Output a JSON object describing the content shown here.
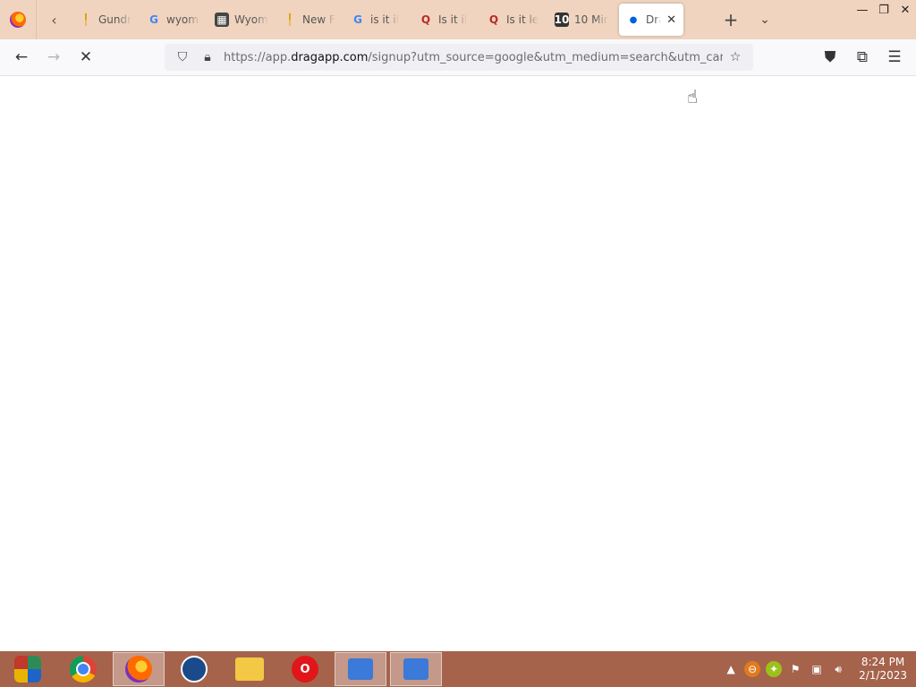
{
  "browser": {
    "tabs": [
      {
        "title": "Gundr",
        "icon": "pin-favicon-icon"
      },
      {
        "title": "wyomi",
        "icon": "google-icon"
      },
      {
        "title": "Wyom",
        "icon": "image-favicon-icon"
      },
      {
        "title": "New F",
        "icon": "pin-favicon-icon"
      },
      {
        "title": "is it il",
        "icon": "google-icon"
      },
      {
        "title": "Is it il",
        "icon": "quora-icon"
      },
      {
        "title": "Is it le",
        "icon": "quora-icon"
      },
      {
        "title": "10 Min",
        "icon": "ten-favicon-icon"
      },
      {
        "title": "Dra",
        "icon": "loading-dot-icon",
        "active": true
      }
    ],
    "url_prefix": "https://app.",
    "url_domain": "dragapp.com",
    "url_rest": "/signup?utm_source=google&utm_medium=search&utm_campaign=drag",
    "new_tab_label": "+",
    "accent": "#0060df",
    "tab_strip_color": "#f0d4bf"
  },
  "taskbar": {
    "color": "#a5634b",
    "apps": [
      "windows-media-center-icon",
      "chrome-icon",
      "firefox-icon",
      "obama-logo-icon",
      "file-explorer-icon",
      "opera-icon",
      "network-icon",
      "network-icon"
    ],
    "time": "8:24 PM",
    "date": "2/1/2023"
  }
}
